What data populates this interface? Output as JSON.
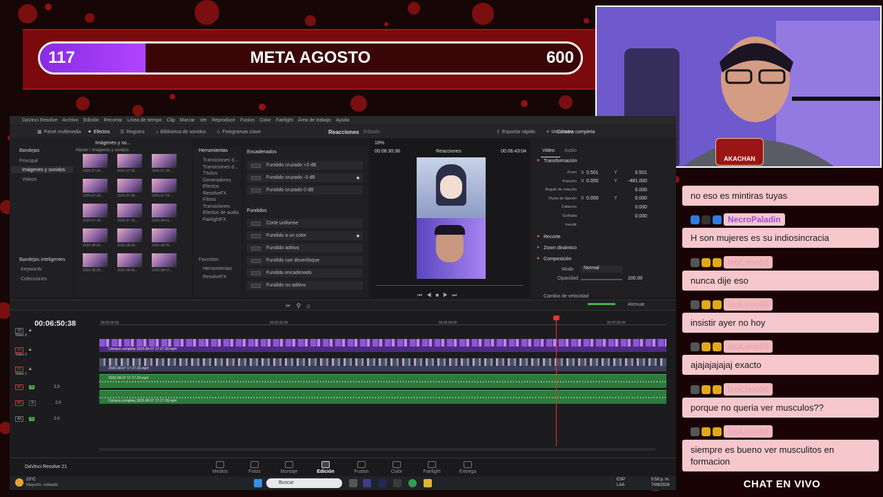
{
  "goal": {
    "current": "117",
    "title": "META AGOSTO",
    "target": "600",
    "progress_fraction": 0.195,
    "colors": {
      "fill": "#9b3cf0",
      "panel": "#7a0a0c"
    }
  },
  "webcam": {
    "logo_text": "AKACHAN"
  },
  "chat": {
    "title": "CHAT EN VIVO",
    "messages": [
      {
        "text": "no eso es mintiras tuyas",
        "user": ""
      },
      {
        "text": "H son mujeres es su indiosincracia",
        "user": "NecroPaladin"
      },
      {
        "text": "nunca dije eso",
        "user": "leoLimo06"
      },
      {
        "text": "insistir ayer no hoy",
        "user": "leoLimo06"
      },
      {
        "text": "ajajajajajaj exacto",
        "user": "leoLimo06"
      },
      {
        "text": "porque no queria ver musculos??",
        "user": "leoLimo06"
      },
      {
        "text": "siempre es bueno ver musculitos en formacion",
        "user": "leoLimo06"
      }
    ]
  },
  "resolve": {
    "menu": [
      "DaVinci Resolve",
      "Archivo",
      "Edición",
      "Recortar",
      "Línea de tiempo",
      "Clip",
      "Marcar",
      "Ver",
      "Reproducir",
      "Fusion",
      "Color",
      "Fairlight",
      "Área de trabajo",
      "Ayuda"
    ],
    "toolbar": {
      "media_panel": "Panel multimedia",
      "effects": "Efectos",
      "register": "Registro",
      "sound_library": "Biblioteca de sonidos",
      "keyframes": "Fotogramas clave",
      "project_title": "Reacciones",
      "edited": "Editado",
      "quick_export": "Exportar rápido",
      "mixer": "Mezclador",
      "inspector_clip": "Cámara completa"
    },
    "media_pool": {
      "bins_header": "Bandejas",
      "bins": [
        "Principal",
        "Imágenes y sonidos",
        "Videos"
      ],
      "smart_bins_header": "Bandejas inteligentes",
      "smart_bins": [
        "Keywords",
        "Colecciones"
      ],
      "path": "Master / Imágenes y sonidos",
      "dropdown": "Imágenes y so...",
      "thumb_labels": [
        "2026-07-24...",
        "2026-07-26...",
        "2026-07-26...",
        "2026-07-28...",
        "2026-07-28...",
        "2026-07-29...",
        "2026-07-30...",
        "2026-07-30...",
        "2026-08-01...",
        "2026-08-02...",
        "2026-08-05...",
        "2026-08-05...",
        "2026-08-05...",
        "2026-08-06...",
        "2026-08-07..."
      ]
    },
    "effects_tree": {
      "header": "Herramientas",
      "items": [
        "Transiciones d...",
        "Transiciones d...",
        "Títulos",
        "Generadores",
        "Efectos",
        "ResolveFX",
        "Filtros",
        "Transiciones",
        "Efectos de audio",
        "FairlightFX"
      ],
      "favorites_header": "Favoritos",
      "favorites": [
        "Herramientas",
        "ResolveFX"
      ]
    },
    "effects_list": {
      "group1": "Encadenados",
      "items1": [
        "Fundido cruzado +3 dB",
        "Fundido cruzado -3 dB",
        "Fundido cruzado 0 dB"
      ],
      "group2": "Fundidos",
      "items2": [
        "Corte uniforme",
        "Fundido a un color",
        "Fundido aditivo",
        "Fundido con desenfoque",
        "Fundido encadenado",
        "Fundido no aditivo"
      ]
    },
    "viewer": {
      "zoom": "18%",
      "timecode_left": "00:08:30:36",
      "title": "Reacciones",
      "timecode_right": "00:06:43:04"
    },
    "inspector": {
      "tabs": [
        "Video",
        "Audio"
      ],
      "sections": [
        "Transformación",
        "Recorte",
        "Zoom dinámico",
        "Composición",
        "Cambio de velocidad"
      ],
      "rows": [
        {
          "label": "Zoom",
          "a_label": "X",
          "a": "0.501",
          "b_label": "Y",
          "b": "0.501"
        },
        {
          "label": "Posición",
          "a_label": "X",
          "a": "0.000",
          "b_label": "Y",
          "b": "-481.000"
        },
        {
          "label": "Ángulo de rotación",
          "a_label": "",
          "a": "",
          "b_label": "",
          "b": "0.000"
        },
        {
          "label": "Punto de fijación",
          "a_label": "X",
          "a": "0.000",
          "b_label": "Y",
          "b": "0.000"
        },
        {
          "label": "Cabeceo",
          "a_label": "",
          "a": "",
          "b_label": "",
          "b": "0.000"
        },
        {
          "label": "Guiñada",
          "a_label": "",
          "a": "",
          "b_label": "",
          "b": "0.000"
        },
        {
          "label": "Invertir",
          "a_label": "",
          "a": "",
          "b_label": "",
          "b": ""
        }
      ],
      "mode_label": "Modo",
      "mode_value": "Normal",
      "opacity_label": "Opacidad",
      "opacity_value": "100.00"
    },
    "timeline": {
      "timecode": "00:06:50:38",
      "ruler": [
        "00:00:00:00",
        "00:02:32:00",
        "00:05:04:00",
        "00:07:36:00"
      ],
      "mute_label": "Atenuar",
      "tracks": [
        {
          "id": "V3",
          "name": "Video 3"
        },
        {
          "id": "V2",
          "name": "Video 2"
        },
        {
          "id": "V1",
          "name": "Video 1"
        },
        {
          "id": "A1",
          "vol": "2.0"
        },
        {
          "id": "A2",
          "vol": "2.0"
        },
        {
          "id": "A3",
          "vol": "2.0"
        }
      ],
      "clip_v2": "Cámara completa 2026-08-07 17-27-39.mp4",
      "clip_v1": "2026-08-07 17-27-39.mp4",
      "clip_a1": "2026-08-07 17-27-39.mp4",
      "clip_a2": "Cámara completa 2026-08-07 17-27-39.mp4",
      "playhead_fraction": 0.805
    },
    "pages": [
      "Medios",
      "Fotos",
      "Montaje",
      "Edición",
      "Fusion",
      "Color",
      "Fairlight",
      "Entrega"
    ],
    "active_page": "Edición",
    "app_name": "DaVinci Resolve 21"
  },
  "taskbar": {
    "weather_temp": "23°C",
    "weather_desc": "Mayorm. soleado",
    "search": "Buscar",
    "lang_top": "ESP",
    "lang_bottom": "LAA",
    "time": "5:58 p. m.",
    "date": "7/08/2026"
  }
}
